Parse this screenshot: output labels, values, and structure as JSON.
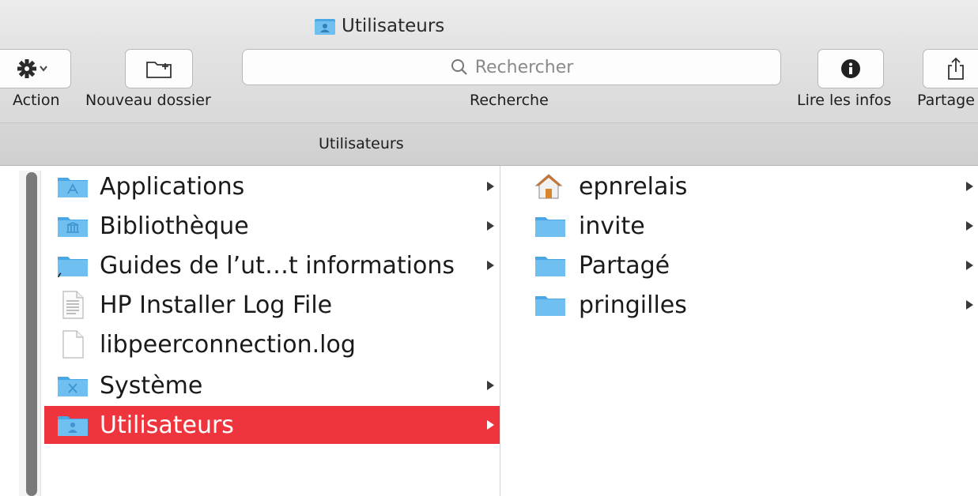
{
  "window": {
    "title": "Utilisateurs"
  },
  "toolbar": {
    "action_label": "Action",
    "new_folder_label": "Nouveau dossier",
    "search_label": "Recherche",
    "search_placeholder": "Rechercher",
    "info_label": "Lire les infos",
    "share_label": "Partage"
  },
  "pathbar": {
    "current": "Utilisateurs"
  },
  "columns": [
    {
      "items": [
        {
          "label": "Applications",
          "icon": "applications-folder-icon",
          "has_children": true,
          "selected": false
        },
        {
          "label": "Bibliothèque",
          "icon": "library-folder-icon",
          "has_children": true,
          "selected": false
        },
        {
          "label": "Guides de l’ut…t informations",
          "icon": "folder-alias-icon",
          "has_children": true,
          "selected": false
        },
        {
          "label": "HP Installer Log File",
          "icon": "text-document-icon",
          "has_children": false,
          "selected": false
        },
        {
          "label": "libpeerconnection.log",
          "icon": "blank-document-icon",
          "has_children": false,
          "selected": false
        },
        {
          "label": "Système",
          "icon": "system-folder-icon",
          "has_children": true,
          "selected": false
        },
        {
          "label": "Utilisateurs",
          "icon": "users-folder-icon",
          "has_children": true,
          "selected": true
        }
      ]
    },
    {
      "items": [
        {
          "label": "epnrelais",
          "icon": "home-icon",
          "has_children": true,
          "selected": false
        },
        {
          "label": "invite",
          "icon": "folder-icon",
          "has_children": true,
          "selected": false
        },
        {
          "label": "Partagé",
          "icon": "folder-icon",
          "has_children": true,
          "selected": false
        },
        {
          "label": "pringilles",
          "icon": "folder-icon",
          "has_children": true,
          "selected": false
        }
      ]
    }
  ],
  "colors": {
    "selection": "#ee343c",
    "folder": "#6fbff0",
    "folder_tab": "#4aa6e4"
  }
}
